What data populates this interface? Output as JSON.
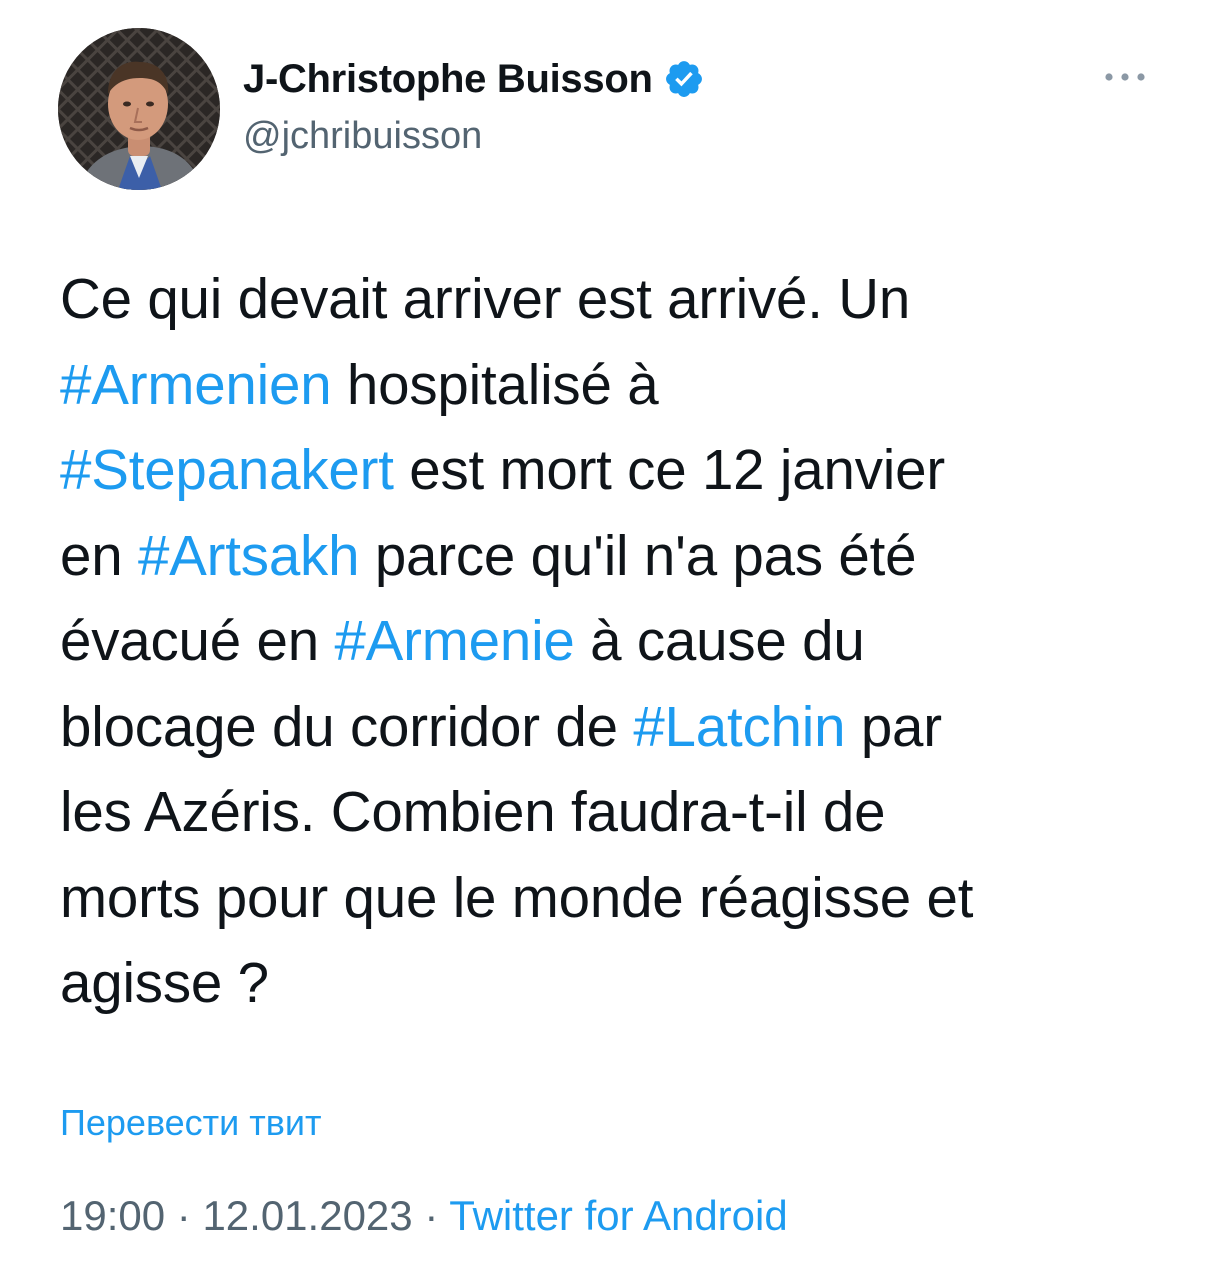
{
  "author": {
    "display_name": "J-Christophe Buisson",
    "handle": "@jchribuisson",
    "verified_icon": "verified-badge-icon",
    "avatar_icon": "avatar-photo"
  },
  "more_icon": "more-options-icon",
  "tweet": {
    "lines": [
      [
        {
          "text": "Ce qui devait arriver est arrivé. Un",
          "type": "text"
        }
      ],
      [
        {
          "text": "#Armenien",
          "type": "hashtag"
        },
        {
          "text": " hospitalisé à",
          "type": "text"
        }
      ],
      [
        {
          "text": "#Stepanakert",
          "type": "hashtag"
        },
        {
          "text": " est mort ce 12 janvier",
          "type": "text"
        }
      ],
      [
        {
          "text": "en ",
          "type": "text"
        },
        {
          "text": "#Artsakh",
          "type": "hashtag"
        },
        {
          "text": " parce qu'il n'a pas été",
          "type": "text"
        }
      ],
      [
        {
          "text": "évacué en ",
          "type": "text"
        },
        {
          "text": "#Armenie",
          "type": "hashtag"
        },
        {
          "text": " à cause du",
          "type": "text"
        }
      ],
      [
        {
          "text": "blocage du corridor de ",
          "type": "text"
        },
        {
          "text": "#Latchin",
          "type": "hashtag"
        },
        {
          "text": " par",
          "type": "text"
        }
      ],
      [
        {
          "text": "les Azéris. Combien faudra-t-il de",
          "type": "text"
        }
      ],
      [
        {
          "text": "morts pour que le monde réagisse et",
          "type": "text"
        }
      ],
      [
        {
          "text": "agisse ?",
          "type": "text"
        }
      ]
    ]
  },
  "translate_label": "Перевести твит",
  "meta": {
    "time": "19:00",
    "separator": " · ",
    "date": "12.01.2023",
    "source": "Twitter for Android"
  },
  "colors": {
    "text": "#0f1419",
    "secondary": "#536471",
    "accent": "#1d9bf0",
    "background": "#ffffff"
  }
}
